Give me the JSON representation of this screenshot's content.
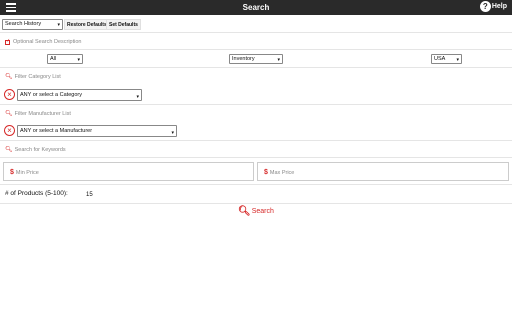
{
  "header": {
    "title": "Search",
    "help_label": "Help"
  },
  "toolbar": {
    "history_select": "Search History",
    "restore_label": "Restore Defaults",
    "set_label": "Set Defaults"
  },
  "description": {
    "label": "Optional Search Description"
  },
  "filters": {
    "status_select": "All",
    "type_select": "Inventory",
    "country_select": "USA"
  },
  "category": {
    "label": "Filter Category List",
    "select": "ANY or select a Category"
  },
  "manufacturer": {
    "label": "Filter Manufacturer List",
    "select": "ANY or select a Manufacturer"
  },
  "keywords": {
    "label": "Search for Keywords"
  },
  "price": {
    "min_placeholder": "Min Price",
    "max_placeholder": "Max Price"
  },
  "products": {
    "label": "# of Products (5-100):",
    "value": "15"
  },
  "search_button": {
    "label": "Search"
  },
  "icons": {
    "menu": "menu-icon",
    "help": "help-icon",
    "check": "check-icon",
    "search": "search-icon",
    "clear": "clear-icon",
    "dollar": "dollar-icon",
    "chevron": "chevron-down-icon"
  },
  "colors": {
    "header_bg": "#2a2a2a",
    "accent": "#d62828"
  }
}
